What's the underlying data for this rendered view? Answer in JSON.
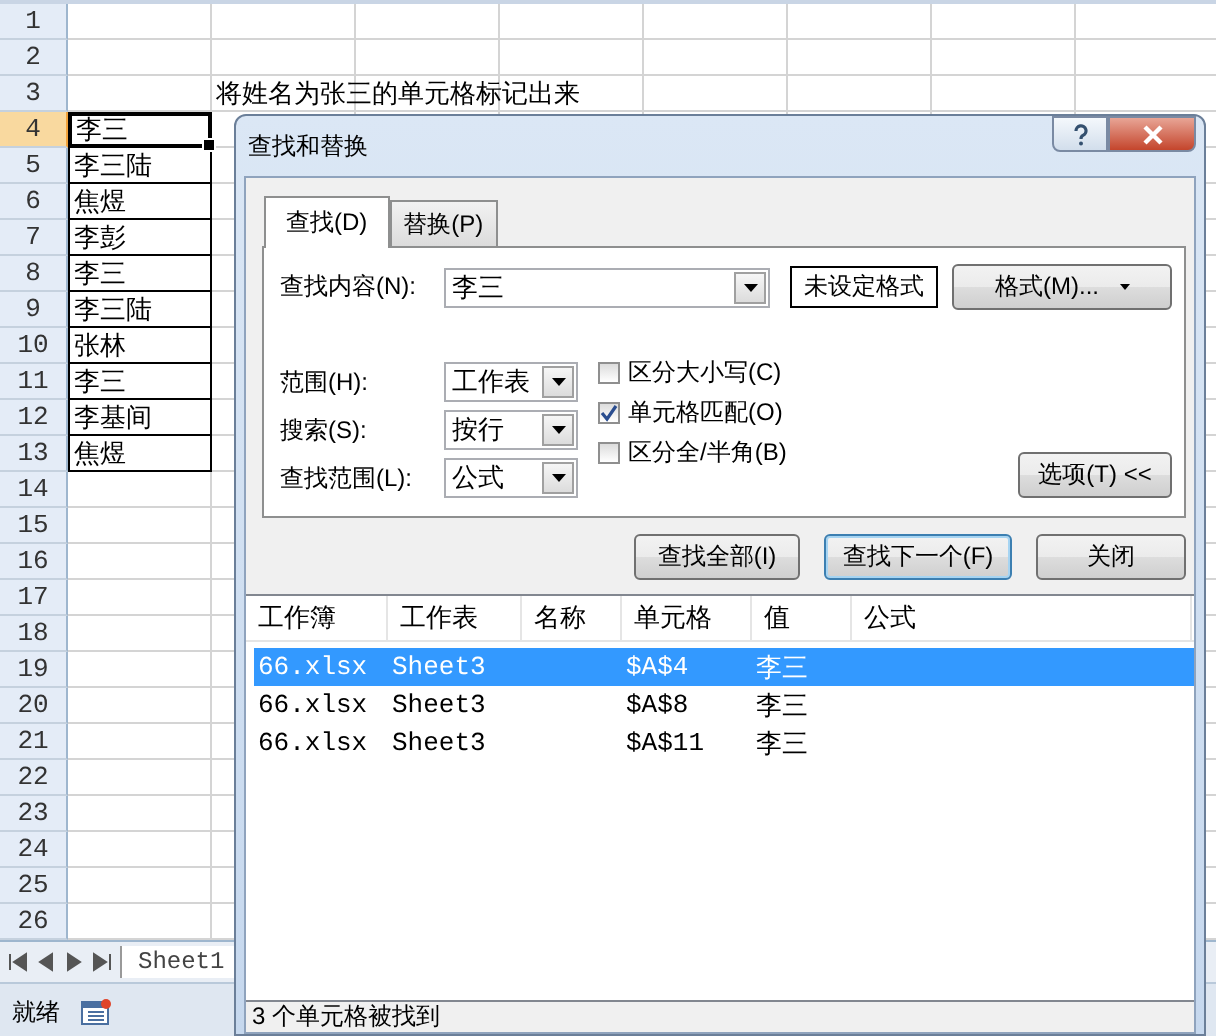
{
  "sheet": {
    "rows": [
      {
        "number": "1",
        "selected": false
      },
      {
        "number": "2",
        "selected": false
      },
      {
        "number": "3",
        "selected": false,
        "col_b": "将姓名为张三的单元格标记出来"
      },
      {
        "number": "4",
        "selected": true,
        "col_a": "李三"
      },
      {
        "number": "5",
        "selected": false,
        "col_a": "李三陆"
      },
      {
        "number": "6",
        "selected": false,
        "col_a": "焦煜"
      },
      {
        "number": "7",
        "selected": false,
        "col_a": "李彭"
      },
      {
        "number": "8",
        "selected": false,
        "col_a": "李三"
      },
      {
        "number": "9",
        "selected": false,
        "col_a": "李三陆"
      },
      {
        "number": "10",
        "selected": false,
        "col_a": "张林"
      },
      {
        "number": "11",
        "selected": false,
        "col_a": "李三"
      },
      {
        "number": "12",
        "selected": false,
        "col_a": "李基间"
      },
      {
        "number": "13",
        "selected": false,
        "col_a": "焦煜"
      },
      {
        "number": "14",
        "selected": false
      },
      {
        "number": "15",
        "selected": false
      },
      {
        "number": "16",
        "selected": false
      },
      {
        "number": "17",
        "selected": false
      },
      {
        "number": "18",
        "selected": false
      },
      {
        "number": "19",
        "selected": false
      },
      {
        "number": "20",
        "selected": false
      },
      {
        "number": "21",
        "selected": false
      },
      {
        "number": "22",
        "selected": false
      },
      {
        "number": "23",
        "selected": false
      },
      {
        "number": "24",
        "selected": false
      },
      {
        "number": "25",
        "selected": false
      },
      {
        "number": "26",
        "selected": false
      }
    ],
    "sheet_tabs": [
      {
        "label": "Sheet1",
        "selected": true
      }
    ],
    "status_bar": {
      "text": "就绪"
    }
  },
  "dialog": {
    "title": "查找和替换",
    "tabs": [
      {
        "label": "查找(D)",
        "selected": true
      },
      {
        "label": "替换(P)",
        "selected": false
      }
    ],
    "find_what": {
      "label": "查找内容(N):",
      "value": "李三"
    },
    "format_status": "未设定格式",
    "format_button": "格式(M)...",
    "selects": [
      {
        "label": "范围(H):",
        "value": "工作表"
      },
      {
        "label": "搜索(S):",
        "value": "按行"
      },
      {
        "label": "查找范围(L):",
        "value": "公式"
      }
    ],
    "checkboxes": [
      {
        "label": "区分大小写(C)",
        "checked": false
      },
      {
        "label": "单元格匹配(O)",
        "checked": true
      },
      {
        "label": "区分全/半角(B)",
        "checked": false
      }
    ],
    "options_button": "选项(T) <<",
    "buttons": [
      {
        "label": "查找全部(I)",
        "focused": false
      },
      {
        "label": "查找下一个(F)",
        "focused": true
      },
      {
        "label": "关闭",
        "focused": false
      }
    ],
    "results": {
      "columns": [
        "工作簿",
        "工作表",
        "名称",
        "单元格",
        "值",
        "公式"
      ],
      "rows": [
        {
          "selected": true,
          "cells": [
            "66.xlsx",
            "Sheet3",
            "",
            "$A$4",
            "李三",
            ""
          ]
        },
        {
          "selected": false,
          "cells": [
            "66.xlsx",
            "Sheet3",
            "",
            "$A$8",
            "李三",
            ""
          ]
        },
        {
          "selected": false,
          "cells": [
            "66.xlsx",
            "Sheet3",
            "",
            "$A$11",
            "李三",
            ""
          ]
        }
      ]
    },
    "status": "3 个单元格被找到"
  }
}
